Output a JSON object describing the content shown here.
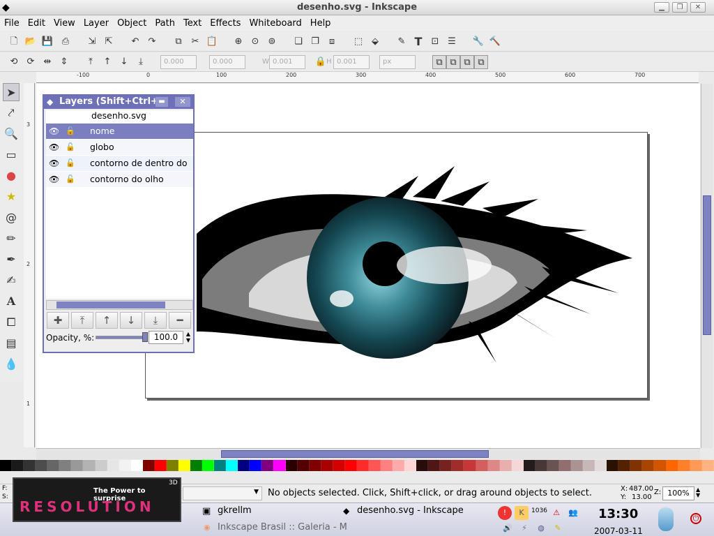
{
  "window": {
    "title": "desenho.svg - Inkscape"
  },
  "menu": [
    "File",
    "Edit",
    "View",
    "Layer",
    "Object",
    "Path",
    "Text",
    "Effects",
    "Whiteboard",
    "Help"
  ],
  "toolbar2": {
    "x": "0.000",
    "y": "0.000",
    "w_label": "W",
    "w": "0.001",
    "h_label": "H",
    "h": "0.001",
    "unit": "px"
  },
  "ruler": {
    "h_ticks": [
      "-100",
      "0",
      "100",
      "200",
      "300",
      "400",
      "500",
      "600",
      "700"
    ],
    "v_ticks": [
      "3",
      "2",
      "1"
    ]
  },
  "layers_dialog": {
    "title": "Layers (Shift+Ctrl+",
    "document": "desenho.svg",
    "layers": [
      {
        "name": "nome",
        "selected": true
      },
      {
        "name": "globo",
        "selected": false
      },
      {
        "name": "contorno de dentro do",
        "selected": false
      },
      {
        "name": "contorno do olho",
        "selected": false
      }
    ],
    "opacity_label": "Opacity, %:",
    "opacity_value": "100.0",
    "opacity_fraction": 1.0
  },
  "palette": [
    "#000000",
    "#1a1a1a",
    "#333333",
    "#4d4d4d",
    "#666666",
    "#808080",
    "#999999",
    "#b3b3b3",
    "#cccccc",
    "#e6e6e6",
    "#f2f2f2",
    "#ffffff",
    "#800000",
    "#ff0000",
    "#808000",
    "#ffff00",
    "#008000",
    "#00ff00",
    "#008080",
    "#00ffff",
    "#000080",
    "#0000ff",
    "#800080",
    "#ff00ff",
    "#2b0000",
    "#550000",
    "#800000",
    "#aa0000",
    "#d40000",
    "#ff0000",
    "#ff2a2a",
    "#ff5555",
    "#ff8080",
    "#ffaaaa",
    "#ffd5d5",
    "#280b0b",
    "#501616",
    "#782121",
    "#a02c2c",
    "#c83737",
    "#d35f5f",
    "#de8787",
    "#e9afaf",
    "#f4d7d7",
    "#241c1c",
    "#483737",
    "#6c5353",
    "#916f6f",
    "#ac9393",
    "#c8b7b7",
    "#e3dbdb",
    "#2b1100",
    "#552200",
    "#803300",
    "#aa4400",
    "#d45500",
    "#ff6600",
    "#ff7f2a",
    "#ff9955",
    "#ffb380"
  ],
  "status": {
    "fill_label": "F:",
    "stroke_label": "S:",
    "layer_value": "",
    "message": "No objects selected. Click, Shift+click, or drag around objects to select.",
    "x_label": "X:",
    "x": "487.00",
    "y_label": "Y:",
    "y": "13.00",
    "zoom_label": "Z:",
    "zoom": "100%"
  },
  "taskbar": {
    "banner_tagline": "The Power to surprise",
    "banner_brand": "RESOLUTION",
    "banner_badge": "3D",
    "task1": "gkrellm",
    "task2": "desenho.svg - Inkscape",
    "task3": "Inkscape Brasil :: Galeria - M",
    "tray_badge": "1036",
    "clock": "13:30",
    "date": "2007-03-11"
  }
}
